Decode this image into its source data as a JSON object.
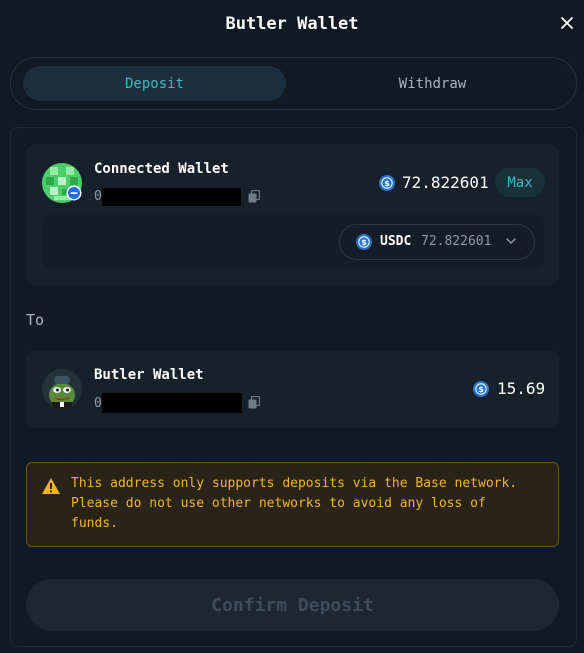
{
  "header": {
    "title": "Butler Wallet"
  },
  "tabs": [
    {
      "label": "Deposit",
      "active": true
    },
    {
      "label": "Withdraw",
      "active": false
    }
  ],
  "from": {
    "wallet_name": "Connected Wallet",
    "address_prefix": "0",
    "token_icon": "usdc-icon",
    "balance": "72.822601",
    "max_label": "Max",
    "token_select": {
      "symbol": "USDC",
      "balance": "72.822601"
    }
  },
  "to": {
    "label": "To",
    "wallet_name": "Butler Wallet",
    "address_prefix": "0",
    "token_icon": "usdc-icon",
    "balance": "15.69"
  },
  "warning": {
    "text": "This address only supports deposits via the Base network.\nPlease do not use other networks to avoid any loss of\nfunds."
  },
  "confirm_label": "Confirm Deposit",
  "colors": {
    "background": "#111a24",
    "card": "#17212c",
    "accent": "#3fb8c4",
    "usdc": "#2775ca",
    "warning": "#f0b429"
  }
}
